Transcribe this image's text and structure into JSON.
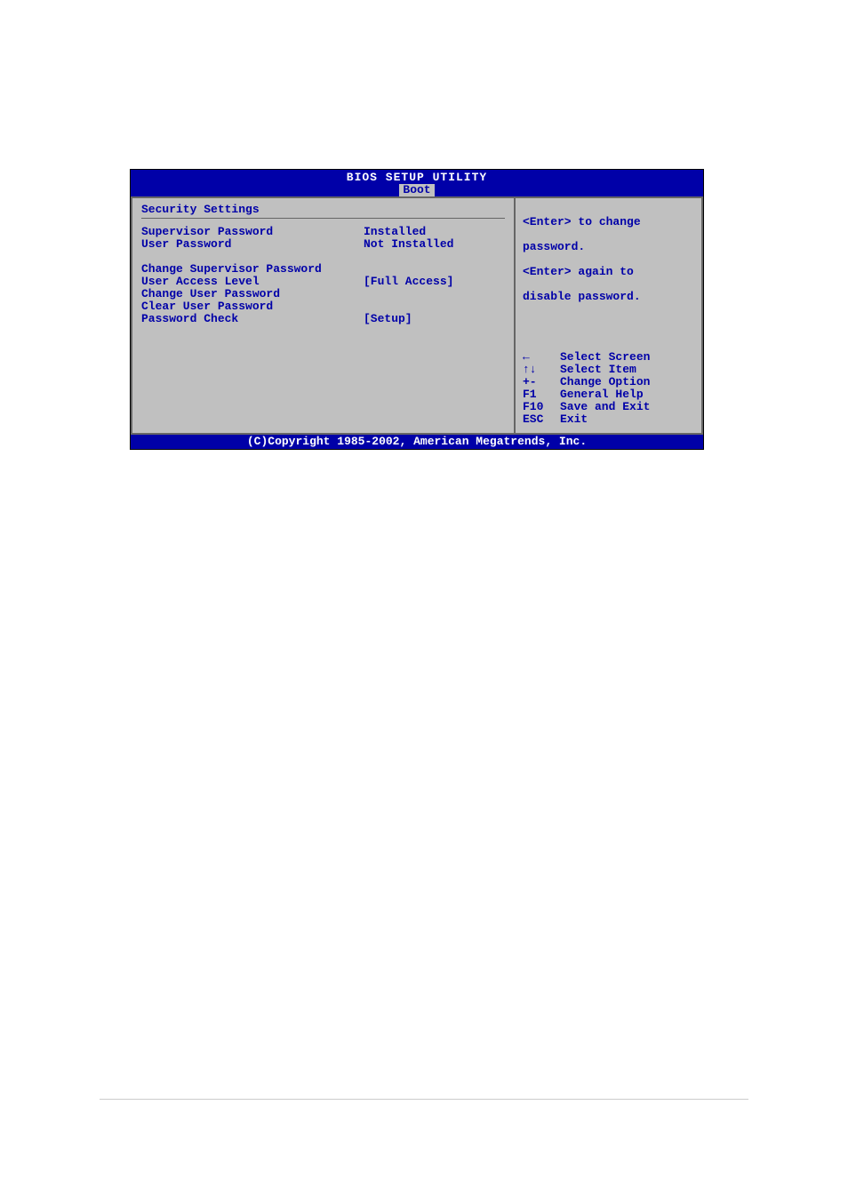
{
  "title": "BIOS SETUP UTILITY",
  "tab": "Boot",
  "section_header": "Security Settings",
  "settings": [
    {
      "label": "Supervisor Password",
      "value": "Installed"
    },
    {
      "label": "User Password",
      "value": "Not Installed"
    }
  ],
  "actions": [
    {
      "label": "Change Supervisor Password",
      "value": ""
    },
    {
      "label": "User Access Level",
      "value": "[Full Access]"
    },
    {
      "label": "Change User Password",
      "value": ""
    },
    {
      "label": "Clear User Password",
      "value": ""
    },
    {
      "label": "Password Check",
      "value": "[Setup]"
    }
  ],
  "help_lines": [
    "<Enter> to change",
    "password.",
    "<Enter> again to",
    "disable password."
  ],
  "nav": [
    {
      "key": "←",
      "desc": "Select Screen"
    },
    {
      "key": "↑↓",
      "desc": "Select Item"
    },
    {
      "key": "+-",
      "desc": "Change Option"
    },
    {
      "key": "F1",
      "desc": "General Help"
    },
    {
      "key": "F10",
      "desc": "Save and Exit"
    },
    {
      "key": "ESC",
      "desc": "Exit"
    }
  ],
  "footer": "(C)Copyright 1985-2002, American Megatrends, Inc."
}
